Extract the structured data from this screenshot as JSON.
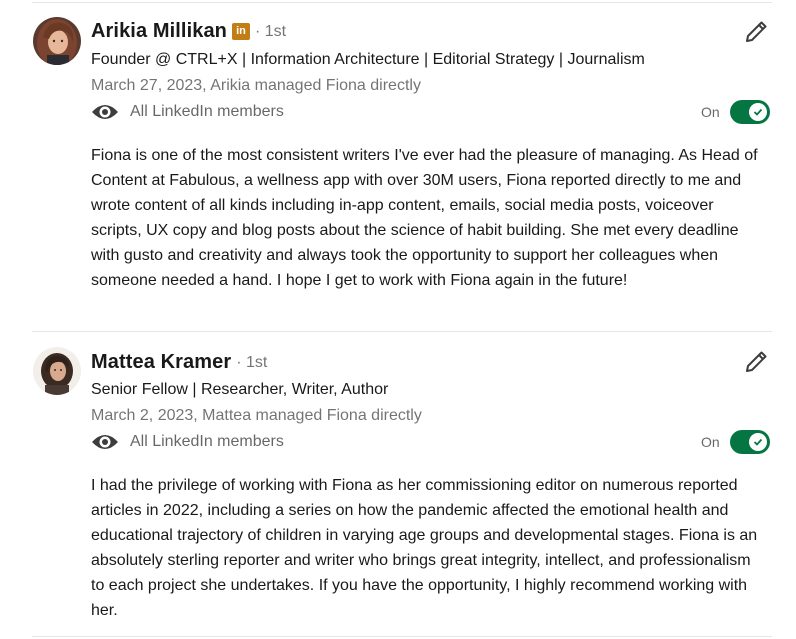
{
  "recommendations": [
    {
      "name": "Arikia Millikan",
      "degree": "· 1st",
      "badge": "in",
      "headline": "Founder @ CTRL+X | Information Architecture | Editorial Strategy | Journalism",
      "relationship": "March 27, 2023, Arikia managed Fiona directly",
      "visibility": "All LinkedIn members",
      "toggle_label": "On",
      "text": "Fiona is one of the most consistent writers I've ever had the pleasure of managing. As Head of Content at Fabulous, a wellness app with over 30M users, Fiona reported directly to me and wrote content of all kinds including in-app content, emails, social media posts, voiceover scripts, UX copy and blog posts about the science of habit building. She met every deadline with gusto and creativity and always took the opportunity to support her colleagues when someone needed a hand. I hope I get to work with Fiona again in the future!"
    },
    {
      "name": "Mattea Kramer",
      "degree": "· 1st",
      "headline": "Senior Fellow | Researcher, Writer, Author",
      "relationship": "March 2, 2023, Mattea managed Fiona directly",
      "visibility": "All LinkedIn members",
      "toggle_label": "On",
      "text": "I had the privilege of working with Fiona as her commissioning editor on numerous reported articles in 2022, including a series on how the pandemic affected the emotional health and educational trajectory of children in varying age groups and developmental stages. Fiona is an absolutely sterling reporter and writer who brings great integrity, intellect, and professionalism to each project she undertakes. If you have the opportunity, I highly recommend working with her."
    }
  ],
  "icons": {
    "edit": "pencil-icon",
    "visibility": "eye-icon",
    "toggle_check": "check-icon"
  },
  "colors": {
    "toggle_on": "#057642",
    "linkedin_badge": "#c37d16",
    "secondary_text": "#737373"
  }
}
